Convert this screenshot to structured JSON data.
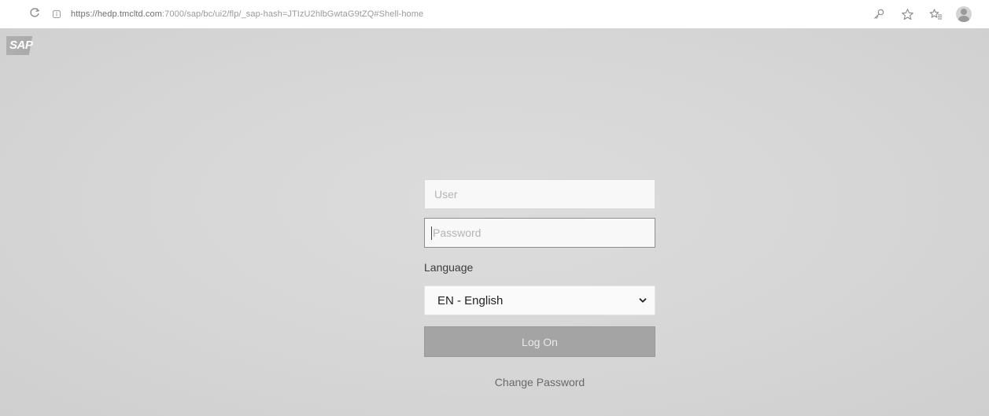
{
  "browser": {
    "url_host": "https://hedp.tmcltd.com",
    "url_path": ":7000/sap/bc/ui2/flp/_sap-hash=JTIzU2hlbGwtaG9tZQ#Shell-home",
    "reload_icon": "reload-icon",
    "info_icon": "site-info-icon",
    "key_icon": "key-icon",
    "star_icon": "star-icon",
    "favorites_icon": "favorites-icon",
    "profile_icon": "profile-avatar-icon"
  },
  "page": {
    "logo_text": "SAP",
    "login": {
      "user_placeholder": "User",
      "password_placeholder": "Password",
      "language_label": "Language",
      "language_selected": "EN - English",
      "logon_label": "Log On",
      "change_password_label": "Change Password"
    }
  }
}
